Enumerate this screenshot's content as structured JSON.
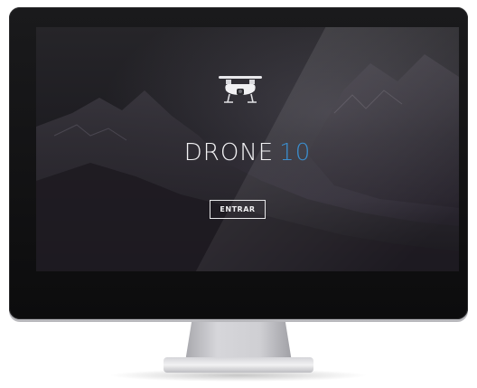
{
  "screen": {
    "brand_primary": "DRONE",
    "brand_secondary": "10",
    "enter_label": "ENTRAR",
    "drone_icon": "drone-icon"
  },
  "device": {
    "logo_icon": "brand-logo-icon"
  },
  "colors": {
    "accent": "#3b8fd0",
    "text": "#f2f2f4",
    "background": "#1f1e23"
  }
}
